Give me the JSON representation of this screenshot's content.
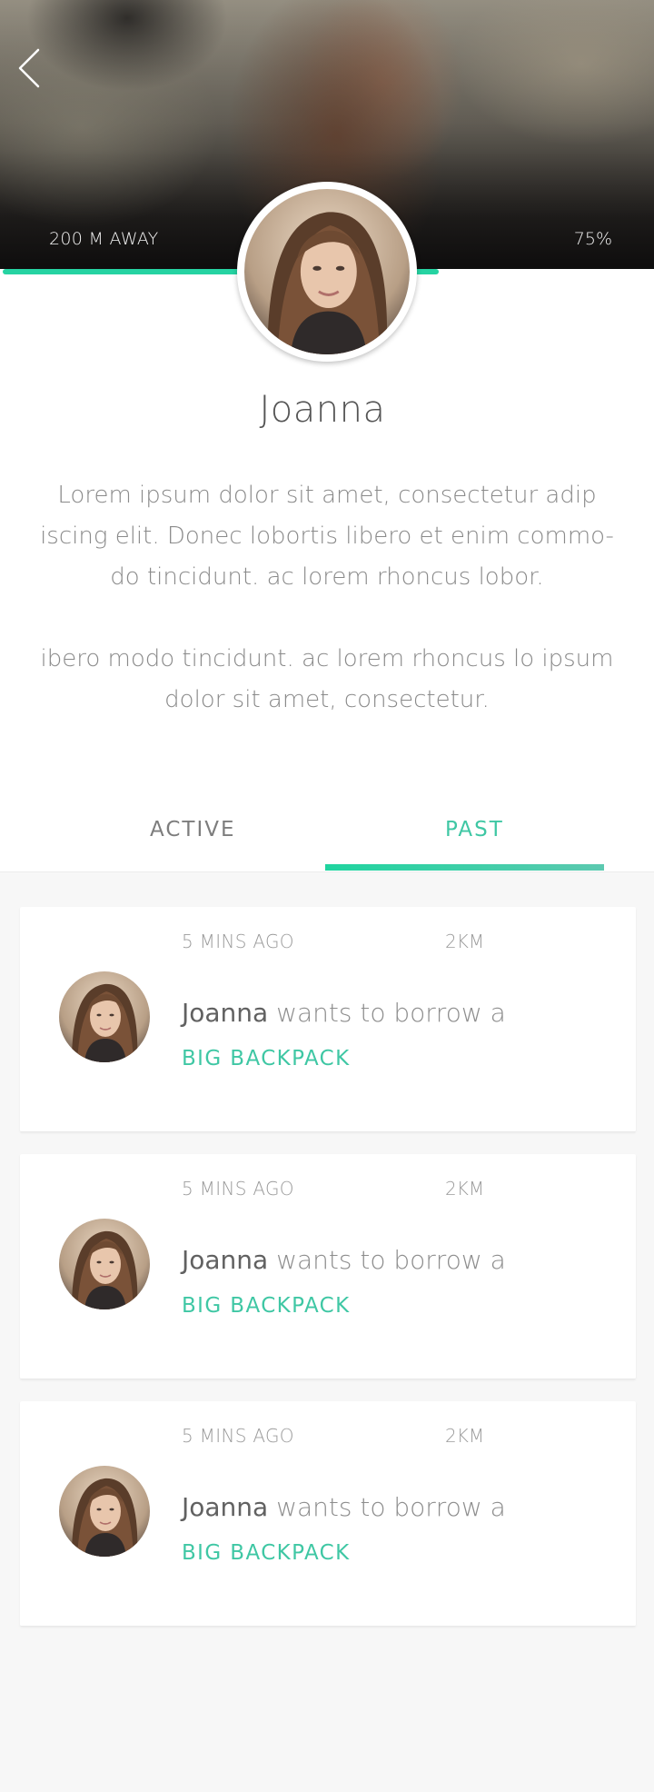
{
  "header": {
    "distance": "200 M AWAY",
    "percent": "75%",
    "progress": 0.75
  },
  "profile": {
    "name": "Joanna",
    "bio_paragraph_1": "Lorem ipsum dolor sit amet, consectetur adip iscing elit. Donec lobortis libero et enim commo-do tincidunt.  ac lorem rhoncus lobor.",
    "bio_paragraph_2": "ibero modo tincidunt.  ac lorem rhoncus lo ipsum dolor sit amet, consectetur."
  },
  "tabs": [
    {
      "label": "ACTIVE",
      "selected": false
    },
    {
      "label": "PAST",
      "selected": true
    }
  ],
  "requests": [
    {
      "time": "5 MINS AGO",
      "distance": "2KM",
      "user": "Joanna",
      "action": "wants to borrow a",
      "item": "BIG BACKPACK"
    },
    {
      "time": "5 MINS AGO",
      "distance": "2KM",
      "user": "Joanna",
      "action": "wants to borrow a",
      "item": "BIG BACKPACK"
    },
    {
      "time": "5 MINS AGO",
      "distance": "2KM",
      "user": "Joanna",
      "action": "wants to borrow a",
      "item": "BIG BACKPACK"
    }
  ],
  "colors": {
    "accent": "#3fc7a4",
    "progress": "#26d3a2",
    "background": "#f7f7f7"
  },
  "icons": {
    "back": "chevron-left-icon",
    "avatar": "user-avatar"
  }
}
